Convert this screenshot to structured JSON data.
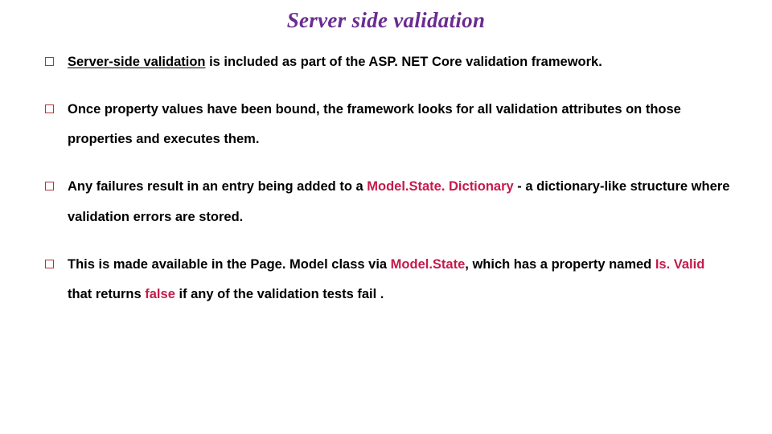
{
  "title": "Server side validation",
  "bullets": {
    "b1": {
      "p1": "Server-side validation",
      "p2": " is included as part of the ASP. NET Core validation framework."
    },
    "b2": {
      "p1": "Once property values have been bound, the framework looks for all validation attributes on those properties and executes them."
    },
    "b3": {
      "p1": " Any failures result in an entry being added to a ",
      "p2": "Model.State. Dictionary",
      "p3": " - a dictionary-like structure where validation errors are stored."
    },
    "b4": {
      "p1": "This is made available in the Page. Model class via ",
      "p2": "Model.State",
      "p3": ", which has a property named ",
      "p4": "Is. Valid",
      "p5": " that returns ",
      "p6": "false",
      "p7": " if any of the validation tests fail ."
    }
  }
}
